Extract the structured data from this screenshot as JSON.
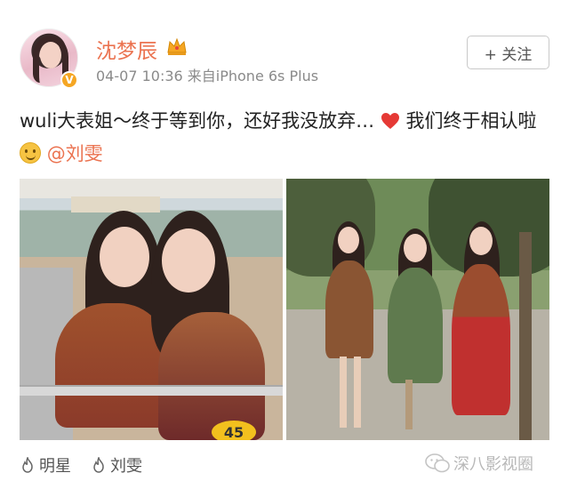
{
  "post": {
    "username": "沈梦辰",
    "timestamp": "04-07 10:36",
    "source": "来自iPhone 6s Plus",
    "follow_label": "+ 关注",
    "text_part1": "wuli大表姐～终于等到你，还好我没放弃…",
    "text_part2": " 我们终于相认啦",
    "mention": "@刘雯",
    "photo_number": "45"
  },
  "tags": [
    {
      "label": "明星",
      "icon": "fire-icon"
    },
    {
      "label": "刘雯",
      "icon": "fire-icon"
    }
  ],
  "watermark": "深八影视圈",
  "colors": {
    "username": "#eb7350",
    "mention": "#eb7350",
    "verified_badge": "#f5a623"
  }
}
